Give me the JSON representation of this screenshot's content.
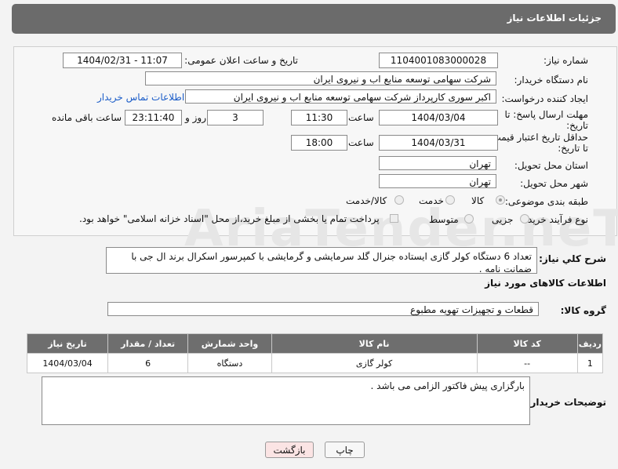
{
  "header": {
    "title": "جزئیات اطلاعات نیاز"
  },
  "watermark": {
    "text": "AriaTender.neT"
  },
  "fields": {
    "need_number_label": "شماره نیاز:",
    "need_number": "1104001083000028",
    "announce_label": "تاریخ و ساعت اعلان عمومی:",
    "announce_value": "1404/02/31 - 11:07",
    "buyer_org_label": "نام دستگاه خریدار:",
    "buyer_org": "شرکت سهامی توسعه منابع اب و نیروی ایران",
    "requester_label": "ایجاد کننده درخواست:",
    "requester": "اکبر سوری کارپرداز شرکت سهامی توسعه منابع اب و نیروی ایران",
    "contact_link": "اطلاعات تماس خریدار",
    "deadline_label_1": "مهلت ارسال پاسخ: تا",
    "deadline_label_2": "تاریخ:",
    "deadline_date": "1404/03/04",
    "time_label": "ساعت",
    "deadline_time": "11:30",
    "days_value": "3",
    "days_label": "روز و",
    "remaining_time": "23:11:40",
    "remaining_label": "ساعت باقی مانده",
    "price_label_1": "حداقل تاریخ اعتبار قیمت:",
    "price_label_2": "تا تاریخ:",
    "price_date": "1404/03/31",
    "price_time": "18:00",
    "province_label": "استان محل تحویل:",
    "province": "تهران",
    "city_label": "شهر محل تحویل:",
    "city": "تهران",
    "category_label": "طبقه بندی موضوعی:",
    "category_options": [
      "کالا",
      "خدمت",
      "کالا/خدمت"
    ],
    "category_selected": "کالا",
    "process_label": "نوع فرآیند خرید :",
    "process_options": [
      "جزیی",
      "متوسط"
    ],
    "payment_note": "پرداخت تمام یا بخشی از مبلغ خرید،از محل \"اسناد خزانه اسلامی\" خواهد بود."
  },
  "summary": {
    "label": "شرح کلي نياز:",
    "text": "تعداد 6 دستگاه کولر گازی ایستاده جنرال گلد سرمایشی و گرمایشی با کمپرسور اسکرال برند ال جی با ضمانت نامه ."
  },
  "goods": {
    "section_title": "اطلاعات کالاهای مورد نیاز",
    "group_label": "گروه کالا:",
    "group_value": "قطعات و تجهیزات تهویه مطبوع",
    "columns": [
      "ردیف",
      "کد کالا",
      "نام کالا",
      "واحد شمارش",
      "تعداد / مقدار",
      "تاریخ نیاز"
    ],
    "rows": [
      {
        "row": "1",
        "code": "--",
        "name": "کولر گازی",
        "unit": "دستگاه",
        "qty": "6",
        "date": "1404/03/04"
      }
    ]
  },
  "buyer_notes": {
    "label": "توضیحات خریدار:",
    "text": "بارگزاری پیش فاکتور الزامی می باشد ."
  },
  "buttons": {
    "print": "چاپ",
    "back": "بازگشت"
  }
}
